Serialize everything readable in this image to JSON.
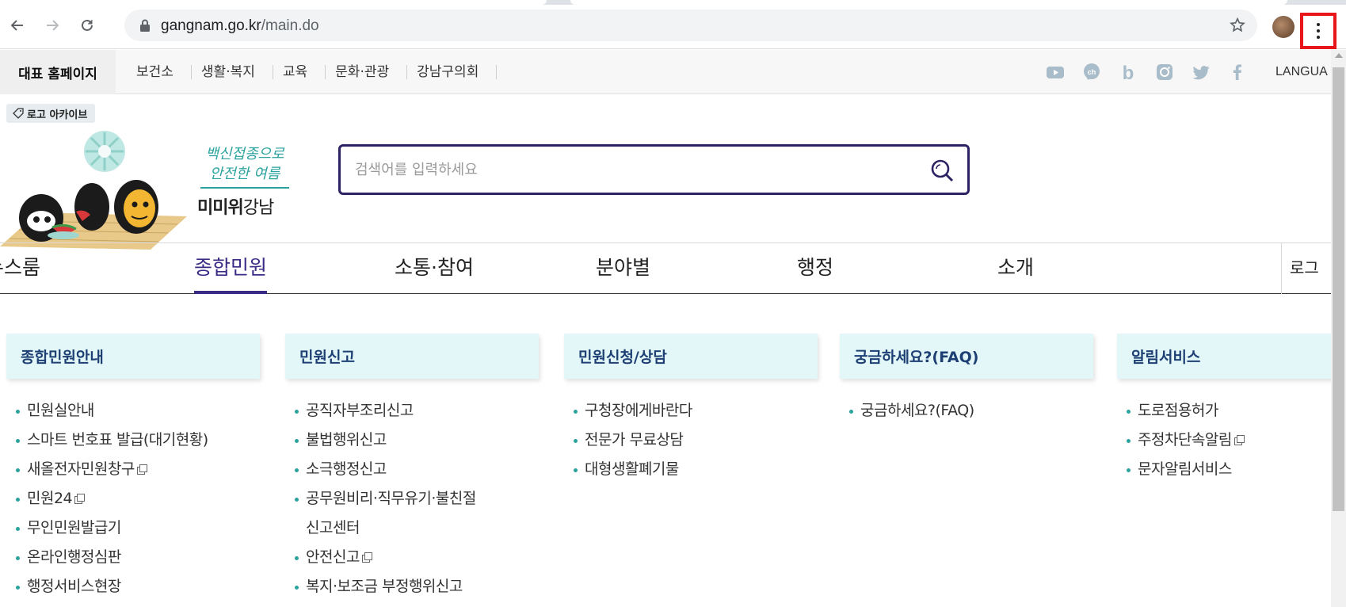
{
  "browser": {
    "url_host": "gangnam.go.kr",
    "url_path": "/main.do"
  },
  "util": {
    "main_home": "대표 홈페이지",
    "sites": [
      "보건소",
      "생활·복지",
      "교육",
      "문화·관광",
      "강남구의회"
    ],
    "social_icons": [
      "youtube-icon",
      "kakao-channel-icon",
      "blog-icon",
      "instagram-icon",
      "twitter-icon",
      "facebook-icon"
    ],
    "language": "LANGUA"
  },
  "logo_archive": "로고 아카이브",
  "campaign": {
    "script_line1": "백신접종으로",
    "script_line2": "안전한 여름",
    "brand_bold": "미미위",
    "brand_regular": "강남"
  },
  "search": {
    "placeholder": "검색어를 입력하세요"
  },
  "gnb": {
    "items": [
      "뉴스룸",
      "종합민원",
      "소통·참여",
      "분야별",
      "행정",
      "소개"
    ],
    "active": "종합민원",
    "login": "로그"
  },
  "columns": [
    {
      "title": "종합민원안내",
      "items": [
        {
          "label": "민원실안내",
          "newwin": false
        },
        {
          "label": "스마트 번호표 발급(대기현황)",
          "newwin": false
        },
        {
          "label": "새올전자민원창구",
          "newwin": true
        },
        {
          "label": "민원24",
          "newwin": true
        },
        {
          "label": "무인민원발급기",
          "newwin": false
        },
        {
          "label": "온라인행정심판",
          "newwin": false
        },
        {
          "label": "행정서비스현장",
          "newwin": false
        }
      ]
    },
    {
      "title": "민원신고",
      "items": [
        {
          "label": "공직자부조리신고",
          "newwin": false
        },
        {
          "label": "불법행위신고",
          "newwin": false
        },
        {
          "label": "소극행정신고",
          "newwin": false
        },
        {
          "label": "공무원비리·직무유기·불친절",
          "label2": "신고센터",
          "newwin": false
        },
        {
          "label": "안전신고",
          "newwin": true
        },
        {
          "label": "복지·보조금 부정행위신고",
          "newwin": false
        }
      ]
    },
    {
      "title": "민원신청/상담",
      "items": [
        {
          "label": "구청장에게바란다",
          "newwin": false
        },
        {
          "label": "전문가 무료상담",
          "newwin": false
        },
        {
          "label": "대형생활폐기물",
          "newwin": false
        }
      ]
    },
    {
      "title": "궁금하세요?(FAQ)",
      "items": [
        {
          "label": "궁금하세요?(FAQ)",
          "newwin": false
        }
      ]
    },
    {
      "title": "알림서비스",
      "items": [
        {
          "label": "도로점용허가",
          "newwin": false
        },
        {
          "label": "주정차단속알림",
          "newwin": true
        },
        {
          "label": "문자알림서비스",
          "newwin": false
        }
      ]
    }
  ]
}
